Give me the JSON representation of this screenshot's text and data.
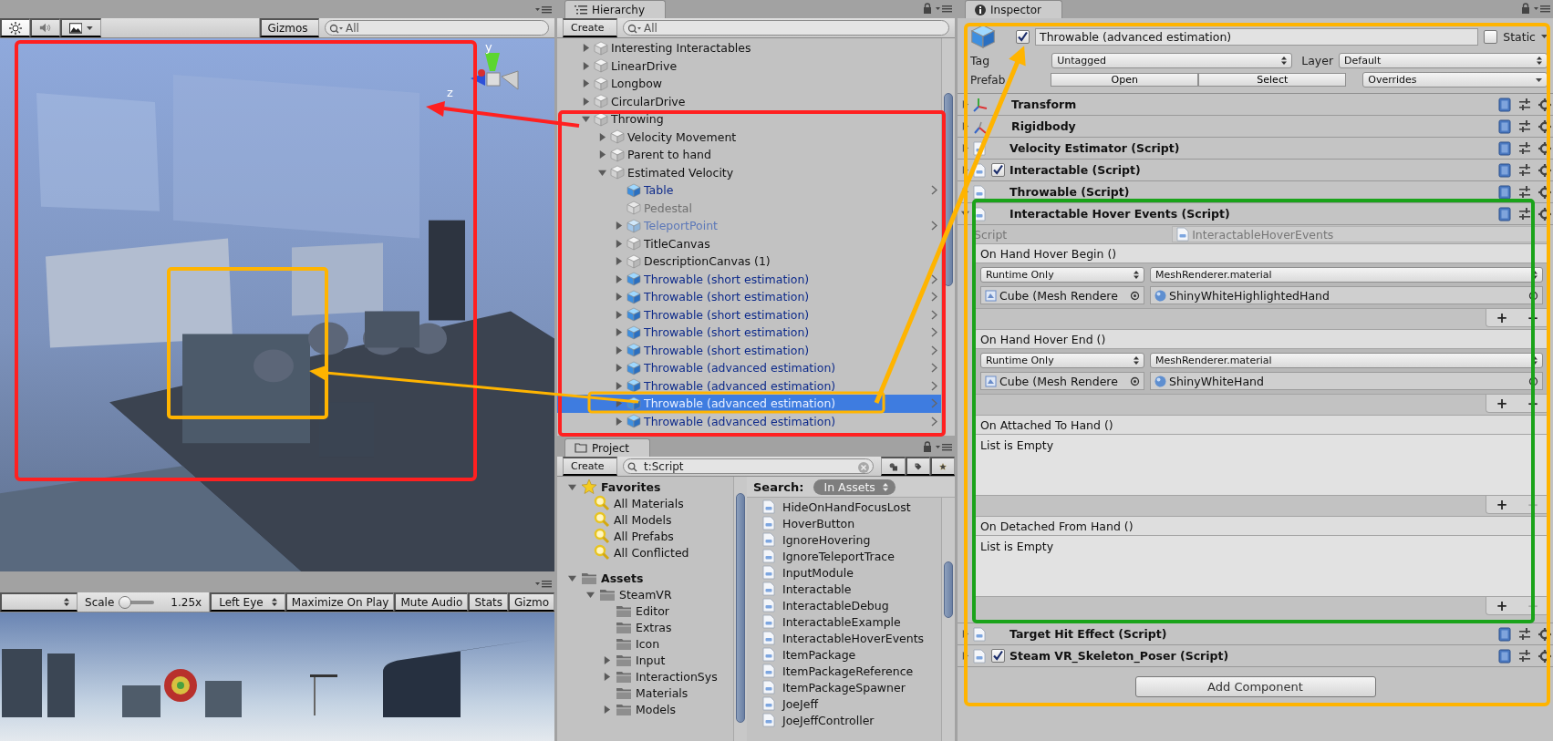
{
  "scene_view": {
    "lighting_on": true,
    "audio_on": false,
    "gizmos": "Gizmos",
    "search_placeholder": "All",
    "axis_labels": [
      "y",
      "z"
    ]
  },
  "game_view": {
    "scale_label": "Scale",
    "level": 0.1,
    "scale_value": "1.25x",
    "eye": "Left Eye",
    "buttons": [
      "Maximize On Play",
      "Mute Audio",
      "Stats",
      "Gizmo"
    ]
  },
  "hierarchy": {
    "tab": "Hierarchy",
    "create": "Create",
    "search_placeholder": "All",
    "items": [
      {
        "name": "Interesting Interactables",
        "kind": "object",
        "expanded": false,
        "selected": false
      },
      {
        "name": "LinearDrive",
        "kind": "object",
        "expanded": false,
        "selected": false
      },
      {
        "name": "Longbow",
        "kind": "object",
        "expanded": false,
        "selected": false
      },
      {
        "name": "CircularDrive",
        "kind": "object",
        "expanded": false,
        "selected": false
      },
      {
        "name": "Throwing",
        "kind": "object",
        "expanded": true,
        "selected": false,
        "children": [
          {
            "name": "Velocity Movement",
            "kind": "object",
            "expanded": false,
            "selected": false
          },
          {
            "name": "Parent to hand",
            "kind": "object",
            "expanded": false,
            "selected": false
          },
          {
            "name": "Estimated Velocity",
            "kind": "object",
            "expanded": true,
            "selected": false,
            "children": [
              {
                "name": "Table",
                "kind": "prefab",
                "selected": false
              },
              {
                "name": "Pedestal",
                "kind": "inactive",
                "selected": false
              },
              {
                "name": "TeleportPoint",
                "kind": "prefab_inactive",
                "expanded": false,
                "selected": false
              },
              {
                "name": "TitleCanvas",
                "kind": "object",
                "expanded": false,
                "selected": false
              },
              {
                "name": "DescriptionCanvas (1)",
                "kind": "object",
                "expanded": false,
                "selected": false
              },
              {
                "name": "Throwable (short estimation)",
                "kind": "prefab",
                "expanded": false,
                "selected": false
              },
              {
                "name": "Throwable (short estimation)",
                "kind": "prefab",
                "expanded": false,
                "selected": false
              },
              {
                "name": "Throwable (short estimation)",
                "kind": "prefab",
                "expanded": false,
                "selected": false
              },
              {
                "name": "Throwable (short estimation)",
                "kind": "prefab",
                "expanded": false,
                "selected": false
              },
              {
                "name": "Throwable (short estimation)",
                "kind": "prefab",
                "expanded": false,
                "selected": false
              },
              {
                "name": "Throwable (advanced estimation)",
                "kind": "prefab",
                "expanded": false,
                "selected": false
              },
              {
                "name": "Throwable (advanced estimation)",
                "kind": "prefab",
                "expanded": false,
                "selected": false
              },
              {
                "name": "Throwable (advanced estimation)",
                "kind": "prefab",
                "expanded": false,
                "selected": true
              },
              {
                "name": "Throwable (advanced estimation)",
                "kind": "prefab",
                "expanded": false,
                "selected": false
              }
            ]
          }
        ]
      }
    ]
  },
  "project": {
    "tab": "Project",
    "create": "Create",
    "search_value": "t:Script",
    "favorites": {
      "label": "Favorites",
      "expanded": true,
      "items": [
        "All Materials",
        "All Models",
        "All Prefabs",
        "All Conflicted"
      ]
    },
    "assets": {
      "label": "Assets",
      "expanded": true,
      "children": [
        {
          "name": "SteamVR",
          "expanded": true,
          "children": [
            {
              "name": "Editor"
            },
            {
              "name": "Extras"
            },
            {
              "name": "Icon"
            },
            {
              "name": "Input",
              "expanded": false
            },
            {
              "name": "InteractionSys",
              "expanded": false
            },
            {
              "name": "Materials"
            },
            {
              "name": "Models",
              "expanded": false
            }
          ]
        }
      ]
    },
    "search_label": "Search:",
    "search_scope": "In Assets",
    "results": [
      "HideOnHandFocusLost",
      "HoverButton",
      "IgnoreHovering",
      "IgnoreTeleportTrace",
      "InputModule",
      "Interactable",
      "InteractableDebug",
      "InteractableExample",
      "InteractableHoverEvents",
      "ItemPackage",
      "ItemPackageReference",
      "ItemPackageSpawner",
      "JoeJeff",
      "JoeJeffController"
    ]
  },
  "inspector": {
    "tab": "Inspector",
    "object": {
      "active": true,
      "name": "Throwable (advanced estimation)",
      "static": false,
      "static_label": "Static",
      "tag_label": "Tag",
      "tag": "Untagged",
      "layer_label": "Layer",
      "layer": "Default",
      "prefab_label": "Prefab",
      "prefab_buttons": [
        "Open",
        "Select"
      ],
      "overrides": "Overrides"
    },
    "components": [
      {
        "name": "Transform",
        "kind": "transform",
        "expanded": false
      },
      {
        "name": "Rigidbody",
        "kind": "rigidbody",
        "expanded": false
      },
      {
        "name": "Velocity Estimator (Script)",
        "kind": "script",
        "expanded": false
      },
      {
        "name": "Interactable (Script)",
        "kind": "script",
        "expanded": false,
        "enabled": true
      },
      {
        "name": "Throwable (Script)",
        "kind": "script",
        "expanded": false
      },
      {
        "name": "Interactable Hover Events (Script)",
        "kind": "script",
        "expanded": true,
        "script_label": "Script",
        "script": "InteractableHoverEvents",
        "events": [
          {
            "title": "On Hand Hover Begin ()",
            "listeners": [
              {
                "mode": "Runtime Only",
                "function": "MeshRenderer.material",
                "target": "Cube (Mesh Rendere",
                "argument": "ShinyWhiteHighlightedHand"
              }
            ],
            "buttons": [
              {
                "label": "+",
                "disabled": false
              },
              {
                "label": "−",
                "disabled": false
              }
            ]
          },
          {
            "title": "On Hand Hover End ()",
            "listeners": [
              {
                "mode": "Runtime Only",
                "function": "MeshRenderer.material",
                "target": "Cube (Mesh Rendere",
                "argument": "ShinyWhiteHand"
              }
            ],
            "buttons": [
              {
                "label": "+",
                "disabled": false
              },
              {
                "label": "−",
                "disabled": false
              }
            ]
          },
          {
            "title": "On Attached To Hand ()",
            "empty_text": "List is Empty",
            "buttons": [
              {
                "label": "+",
                "disabled": false
              },
              {
                "label": "−",
                "disabled": true
              }
            ]
          },
          {
            "title": "On Detached From Hand ()",
            "empty_text": "List is Empty",
            "buttons": [
              {
                "label": "+",
                "disabled": false
              },
              {
                "label": "−",
                "disabled": true
              }
            ]
          }
        ]
      },
      {
        "name": "Target Hit Effect (Script)",
        "kind": "script",
        "expanded": false
      },
      {
        "name": "Steam VR_Skeleton_Poser (Script)",
        "kind": "script",
        "expanded": false,
        "enabled": true
      }
    ],
    "add_component": "Add Component"
  }
}
